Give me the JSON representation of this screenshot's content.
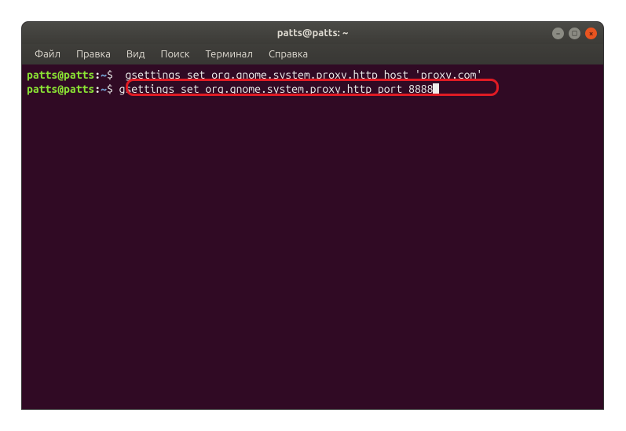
{
  "window": {
    "title": "patts@patts: ~"
  },
  "menubar": {
    "items": [
      {
        "label": "Файл"
      },
      {
        "label": "Правка"
      },
      {
        "label": "Вид"
      },
      {
        "label": "Поиск"
      },
      {
        "label": "Терминал"
      },
      {
        "label": "Справка"
      }
    ]
  },
  "controls": {
    "min": "–",
    "max": "□",
    "close": "×"
  },
  "terminal": {
    "prompt_user": "patts@patts",
    "prompt_colon": ":",
    "prompt_path": "~",
    "prompt_dollar": "$",
    "lines": [
      {
        "cmd": "  gsettings set org.gnome.system.proxy.http host 'proxy.com'"
      },
      {
        "cmd": " gsettings set org.gnome.system.proxy.http port 8888"
      }
    ]
  }
}
